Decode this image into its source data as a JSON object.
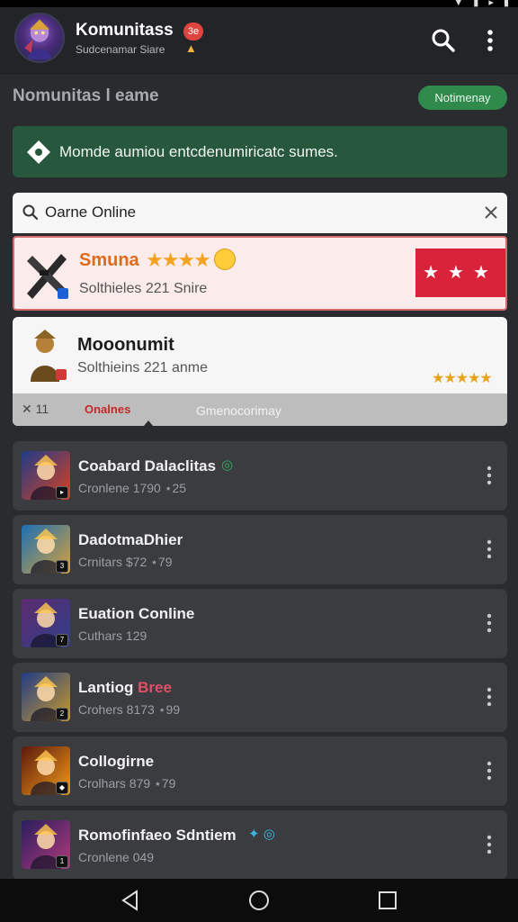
{
  "status_bar": {
    "icons": "▼ ▮ ▸ ▮"
  },
  "app": {
    "title": "Komunitass",
    "badge": "3e",
    "subtitle": "Sudcenamar Siare"
  },
  "section": {
    "title": "Nomunitas l eame",
    "pill_label": "Notimenay"
  },
  "banner": {
    "text": "Momde aumiou entcdenumiricatc sumes."
  },
  "search": {
    "value": "Oarne Online"
  },
  "featured": [
    {
      "title": "Smuna",
      "stars": "★★★★",
      "subtitle": "Solthieles 221 Snire",
      "rating_stars": "★★★"
    },
    {
      "title": "Mooonumit",
      "subtitle": "Solthieins 221 anme",
      "stars": "★★★★★",
      "tab_close": "✕ 11",
      "tab_active": "Onalnes",
      "tab_other": "Gmenocorimay"
    }
  ],
  "games": [
    {
      "title": "Coabard Dalaclitas",
      "subtitle": "Cronlene 1790 ⋆25",
      "badge": "▸",
      "thumb_colors": [
        "#1f3b8a",
        "#d8421d"
      ]
    },
    {
      "title": "DadotmaDhier",
      "subtitle": "Crnitars $72  ⋆79",
      "badge": "3",
      "thumb_colors": [
        "#1b6fb5",
        "#d9a23a"
      ]
    },
    {
      "title": "Euation Conline",
      "subtitle": "Cuthars 129",
      "badge": "7",
      "thumb_colors": [
        "#5d2b6e",
        "#2f3f8a"
      ]
    },
    {
      "title": "Lantiog ",
      "title_accent": "Bree",
      "subtitle": "Crohers 8173  ⋆99",
      "badge": "2",
      "thumb_colors": [
        "#213c86",
        "#c99a2c"
      ]
    },
    {
      "title": "Collogirne",
      "subtitle": "Crolhars 879  ⋆79",
      "badge": "◆",
      "thumb_colors": [
        "#5a1a0c",
        "#f29a1c"
      ]
    },
    {
      "title": "Romofinfaeo Sdntiem",
      "subtitle": "Cronlene 049",
      "badge": "1",
      "thumb_colors": [
        "#2a1e5e",
        "#b23a7c"
      ]
    }
  ]
}
